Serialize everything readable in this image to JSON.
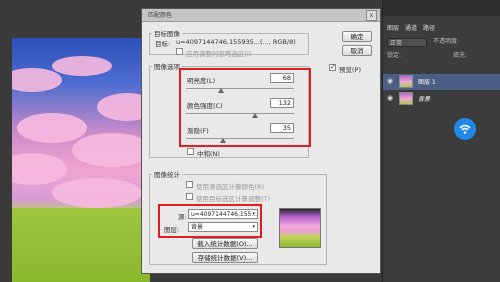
{
  "dialog": {
    "title": "匹配颜色",
    "close_label": "x",
    "target_group_label": "目标图像",
    "target_label": "目标:",
    "target_value": "u=4097144746,155935...(..., RGB/8)",
    "ignore_selection_label": "应用调整时忽略选区(I)",
    "ok_label": "确定",
    "cancel_label": "取消",
    "preview_label": "预览(P)",
    "preview_checked": true,
    "image_options_label": "图像选项",
    "luminance_label": "明亮度(L)",
    "luminance_value": "68",
    "color_intensity_label": "颜色强度(C)",
    "color_intensity_value": "132",
    "fade_label": "渐隐(F)",
    "fade_value": "35",
    "neutralize_label": "中和(N)",
    "stats_group_label": "图像统计",
    "use_selection_source_label": "使用源选区计算颜色(R)",
    "use_selection_target_label": "使用目标选区计算调整(T)",
    "source_label": "源:",
    "source_value": "u=4097144746,155...",
    "layer_label": "图层:",
    "layer_value": "背景",
    "load_stats_label": "载入统计数据(O)...",
    "save_stats_label": "存储统计数据(V)..."
  },
  "panel": {
    "tab1": "图层",
    "tab2": "通道",
    "tab3": "路径",
    "blend_mode": "正常",
    "opacity_label": "不透明度:",
    "lock_label": "锁定:",
    "fill_label": "填充:",
    "layers": [
      {
        "name": "图层 1"
      },
      {
        "name": "背景"
      }
    ]
  },
  "colors": {
    "highlight": "#e02020",
    "layer_selected": "#4b5f84",
    "wifi_badge": "#1f87e6"
  },
  "icons": {
    "eye": "eye-icon",
    "wifi": "wifi-icon",
    "dropdown": "chevron-down-icon"
  }
}
